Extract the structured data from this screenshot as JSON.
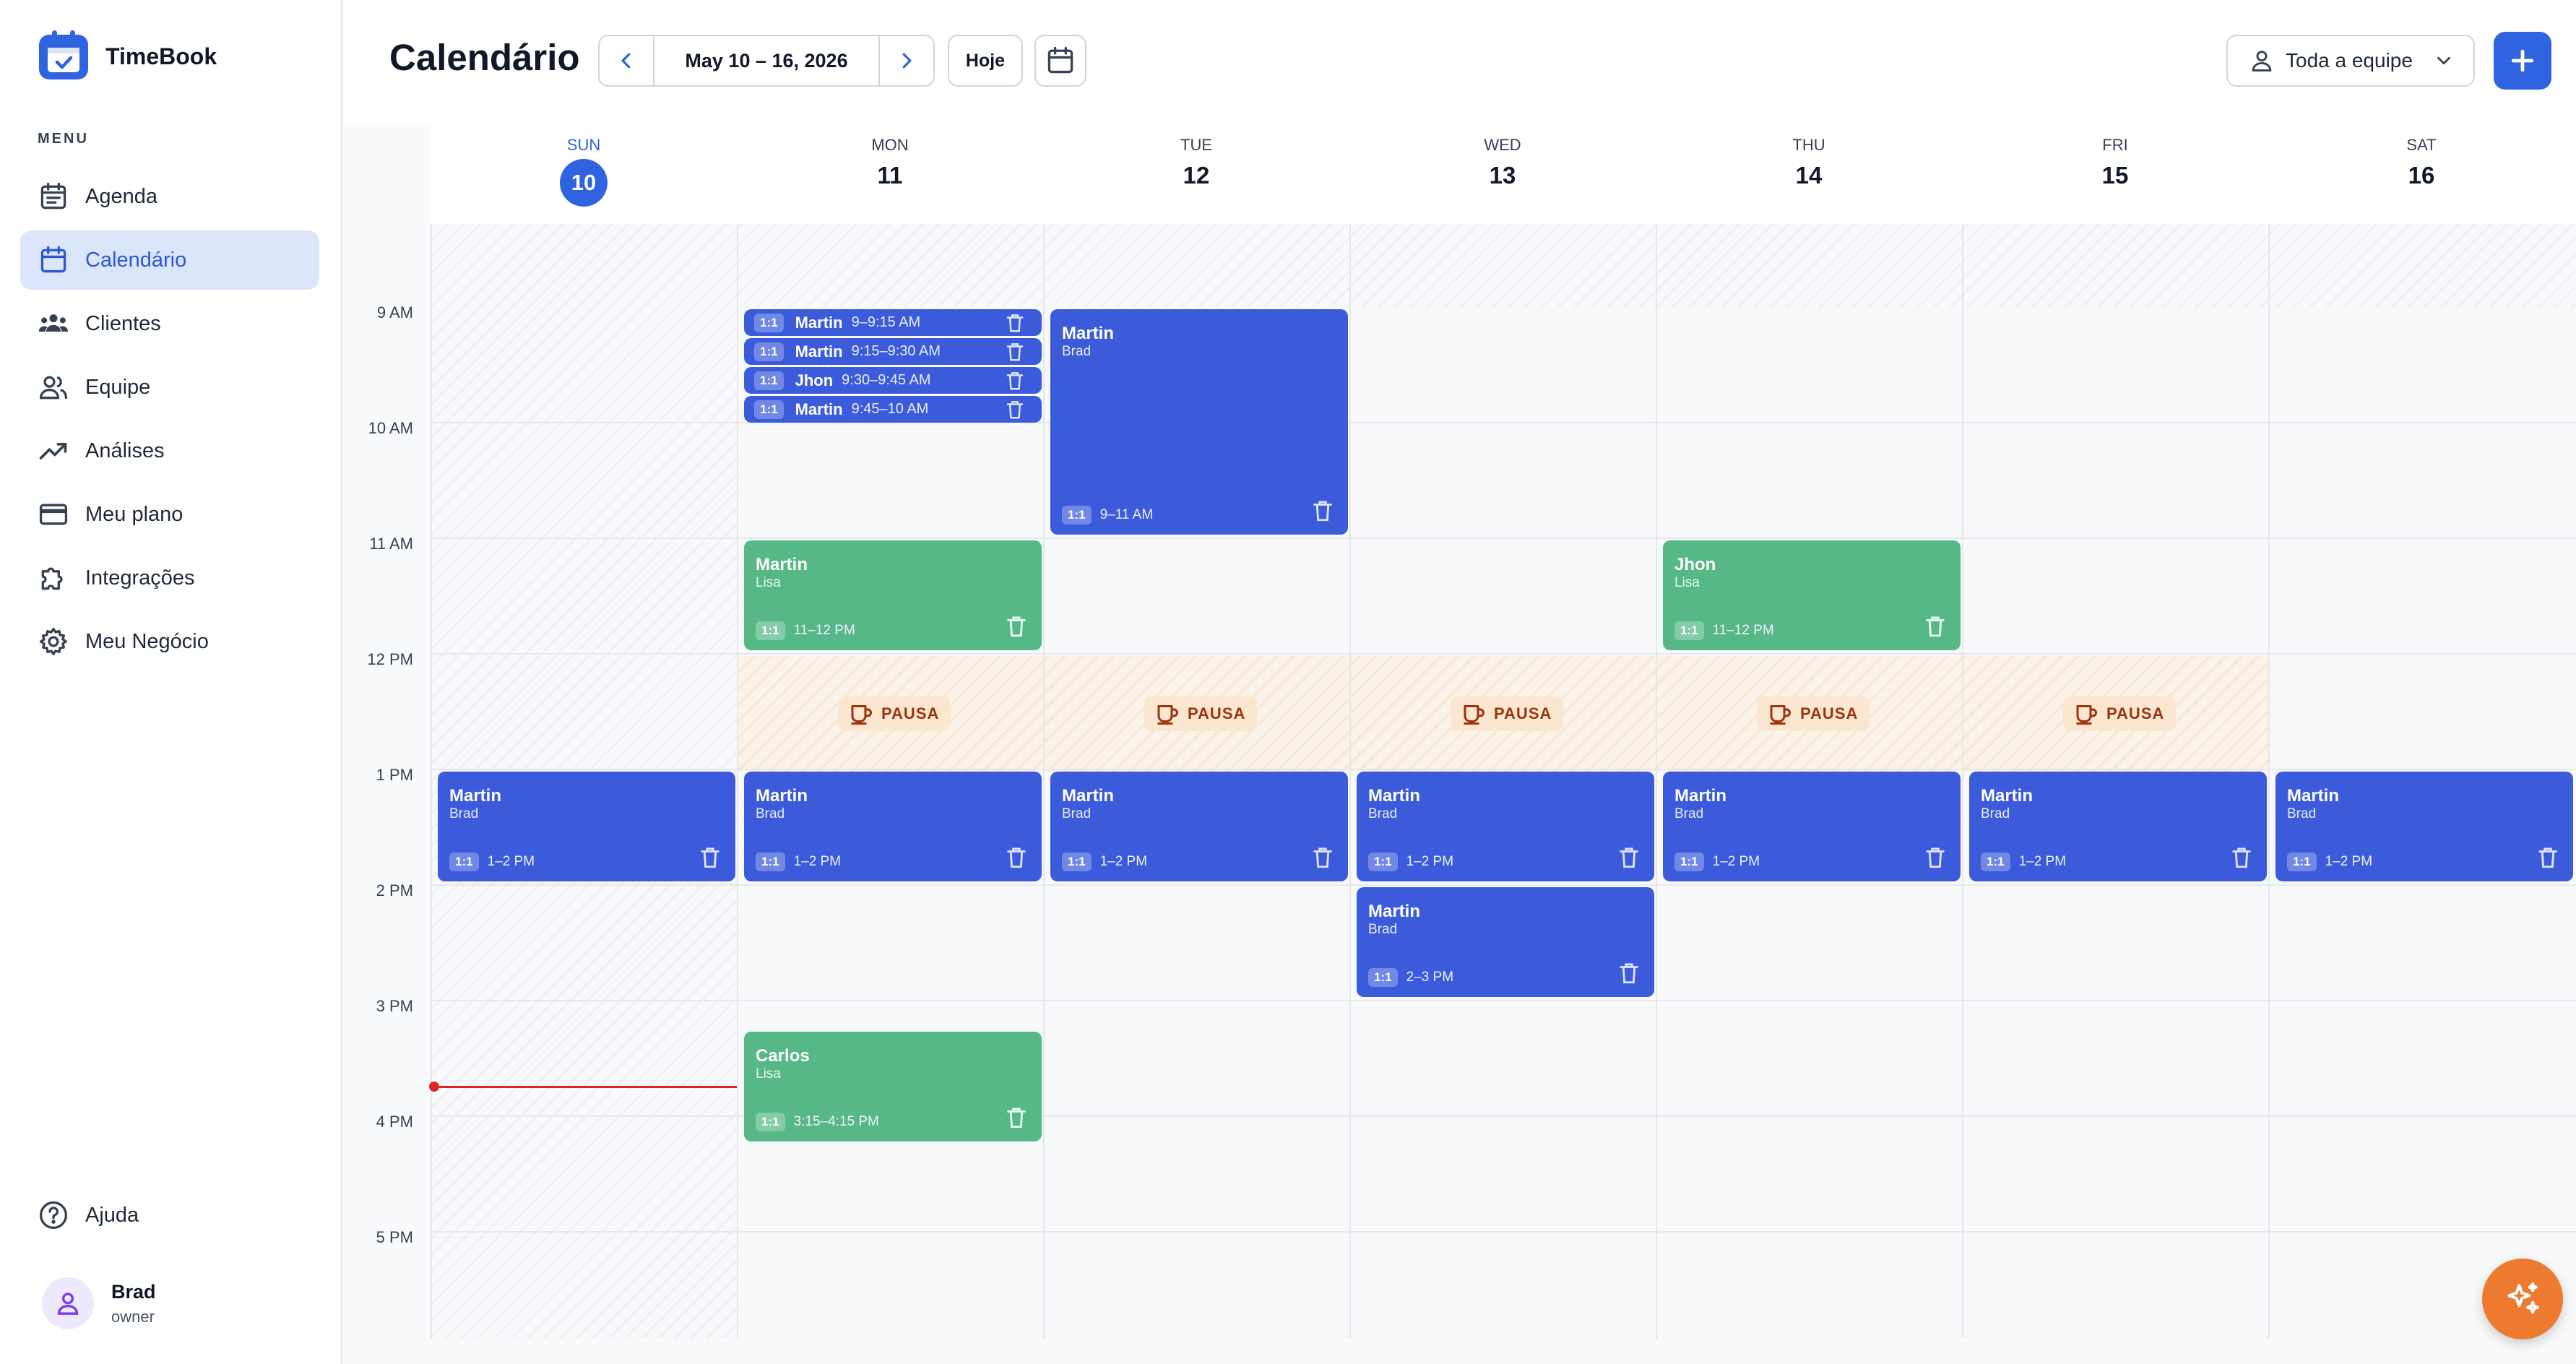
{
  "app": {
    "name": "TimeBook"
  },
  "sidebar": {
    "menu_label": "MENU",
    "items": [
      {
        "label": "Agenda",
        "icon": "agenda-icon",
        "active": false
      },
      {
        "label": "Calendário",
        "icon": "calendar-icon",
        "active": true
      },
      {
        "label": "Clientes",
        "icon": "clients-icon",
        "active": false
      },
      {
        "label": "Equipe",
        "icon": "team-icon",
        "active": false
      },
      {
        "label": "Análises",
        "icon": "trending-icon",
        "active": false
      },
      {
        "label": "Meu plano",
        "icon": "credit-card-icon",
        "active": false
      },
      {
        "label": "Integrações",
        "icon": "puzzle-icon",
        "active": false
      },
      {
        "label": "Meu Negócio",
        "icon": "gear-icon",
        "active": false
      }
    ],
    "help_label": "Ajuda",
    "user": {
      "name": "Brad",
      "role": "owner"
    }
  },
  "header": {
    "title": "Calendário",
    "date_range": "May 10 – 16, 2026",
    "today_label": "Hoje",
    "team_filter": "Toda a equipe"
  },
  "colors": {
    "primary": "#2f63e0",
    "event_blue": "#3b5bdb",
    "event_green": "#55b886",
    "pause_bg": "#fbe7cf",
    "now_line": "#dc2626",
    "fab": "#ee7a2f"
  },
  "week": {
    "days": [
      {
        "name": "SUN",
        "num": "10",
        "today": true
      },
      {
        "name": "MON",
        "num": "11"
      },
      {
        "name": "TUE",
        "num": "12"
      },
      {
        "name": "WED",
        "num": "13"
      },
      {
        "name": "THU",
        "num": "14"
      },
      {
        "name": "FRI",
        "num": "15"
      },
      {
        "name": "SAT",
        "num": "16"
      }
    ],
    "hours": [
      "9 AM",
      "10 AM",
      "11 AM",
      "12 PM",
      "1 PM",
      "2 PM",
      "3 PM",
      "4 PM",
      "5 PM"
    ],
    "pause_label": "PAUSA",
    "events": {
      "mon_9": {
        "name": "Martin",
        "time": "9–9:15 AM",
        "type": "1:1"
      },
      "mon_915": {
        "name": "Martin",
        "time": "9:15–9:30 AM",
        "type": "1:1"
      },
      "mon_930": {
        "name": "Jhon",
        "time": "9:30–9:45 AM",
        "type": "1:1"
      },
      "mon_945": {
        "name": "Martin",
        "time": "9:45–10 AM",
        "type": "1:1"
      },
      "tue_9": {
        "name": "Martin",
        "staff": "Brad",
        "time": "9–11 AM",
        "type": "1:1"
      },
      "mon_11": {
        "name": "Martin",
        "staff": "Lisa",
        "time": "11–12 PM",
        "type": "1:1"
      },
      "thu_11": {
        "name": "Jhon",
        "staff": "Lisa",
        "time": "11–12 PM",
        "type": "1:1"
      },
      "sun_1": {
        "name": "Martin",
        "staff": "Brad",
        "time": "1–2 PM",
        "type": "1:1"
      },
      "mon_1": {
        "name": "Martin",
        "staff": "Brad",
        "time": "1–2 PM",
        "type": "1:1"
      },
      "tue_1": {
        "name": "Martin",
        "staff": "Brad",
        "time": "1–2 PM",
        "type": "1:1"
      },
      "wed_1": {
        "name": "Martin",
        "staff": "Brad",
        "time": "1–2 PM",
        "type": "1:1"
      },
      "thu_1": {
        "name": "Martin",
        "staff": "Brad",
        "time": "1–2 PM",
        "type": "1:1"
      },
      "fri_1": {
        "name": "Martin",
        "staff": "Brad",
        "time": "1–2 PM",
        "type": "1:1"
      },
      "sat_1": {
        "name": "Martin",
        "staff": "Brad",
        "time": "1–2 PM",
        "type": "1:1"
      },
      "wed_2": {
        "name": "Martin",
        "staff": "Brad",
        "time": "2–3 PM",
        "type": "1:1"
      },
      "mon_315": {
        "name": "Carlos",
        "staff": "Lisa",
        "time": "3:15–4:15 PM",
        "type": "1:1"
      }
    }
  }
}
